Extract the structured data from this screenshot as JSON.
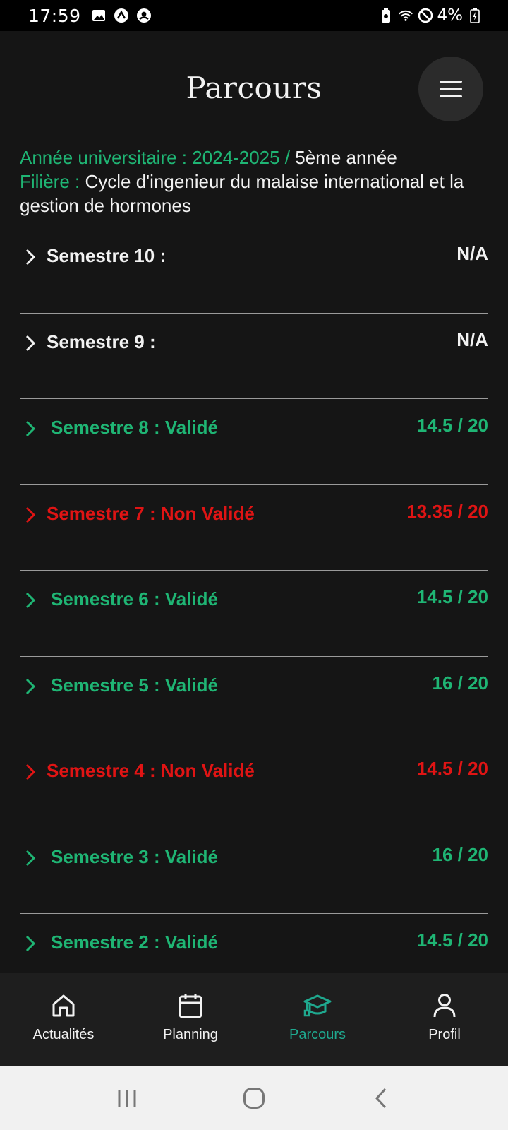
{
  "status_bar": {
    "time": "17:59",
    "battery": "4%",
    "left_icons": [
      "image-icon",
      "app-icon",
      "account-icon"
    ],
    "right_icons": [
      "battery-saver-icon",
      "wifi-icon",
      "do-not-disturb-icon",
      "battery-charging-icon"
    ]
  },
  "header": {
    "title": "Parcours",
    "menu_icon": "hamburger-menu-icon"
  },
  "info": {
    "year_label": "Année universitaire : 2024-2025 /",
    "year_value": "5ème année",
    "filiere_label": "Filière :",
    "filiere_value": "Cycle d'ingenieur du malaise international et la gestion de hormones"
  },
  "semesters": [
    {
      "label": "Semestre 10 :",
      "grade": "N/A",
      "status": "neutral"
    },
    {
      "label": "Semestre 9 :",
      "grade": "N/A",
      "status": "neutral"
    },
    {
      "label": "Semestre 8 : Validé",
      "grade": "14.5 / 20",
      "status": "valid"
    },
    {
      "label": "Semestre 7 : Non Validé",
      "grade": "13.35 / 20",
      "status": "invalid"
    },
    {
      "label": "Semestre 6 : Validé",
      "grade": "14.5 / 20",
      "status": "valid"
    },
    {
      "label": "Semestre 5 : Validé",
      "grade": "16 / 20",
      "status": "valid"
    },
    {
      "label": "Semestre 4 : Non Validé",
      "grade": "14.5 / 20",
      "status": "invalid"
    },
    {
      "label": "Semestre 3 : Validé",
      "grade": "16 / 20",
      "status": "valid"
    },
    {
      "label": "Semestre 2 : Validé",
      "grade": "14.5 / 20",
      "status": "valid"
    }
  ],
  "bottom_nav": [
    {
      "label": "Actualités",
      "icon": "home-icon",
      "active": false
    },
    {
      "label": "Planning",
      "icon": "calendar-icon",
      "active": false
    },
    {
      "label": "Parcours",
      "icon": "graduation-cap-icon",
      "active": true
    },
    {
      "label": "Profil",
      "icon": "user-icon",
      "active": false
    }
  ],
  "colors": {
    "background": "#151515",
    "valid": "#1fb574",
    "invalid": "#e01414",
    "active_nav": "#1fa98f",
    "nav_bg": "#1e1e1e"
  }
}
